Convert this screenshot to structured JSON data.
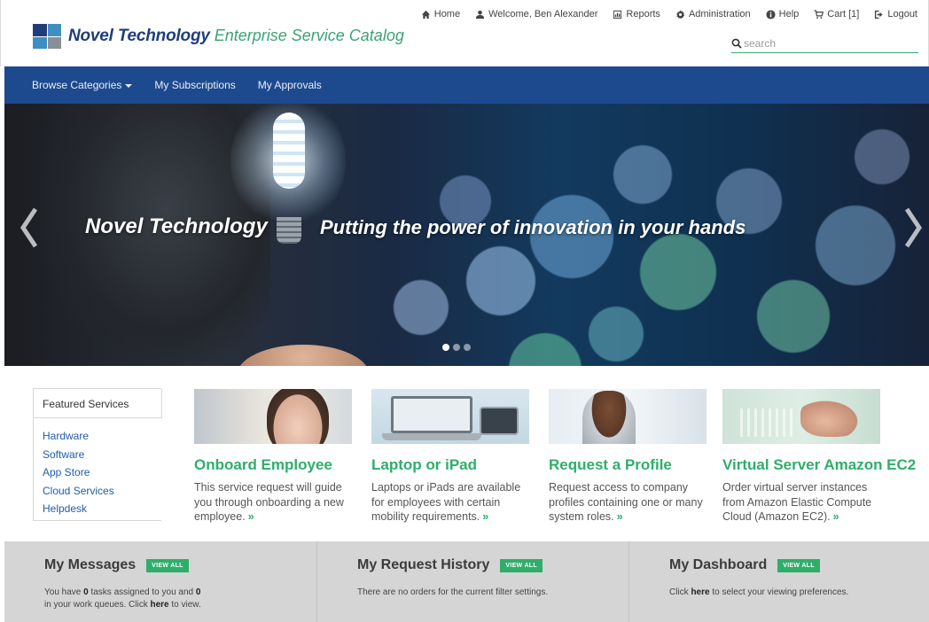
{
  "header": {
    "brand_name": "Novel Technology",
    "brand_sub": "Enterprise Service Catalog",
    "top_links": [
      {
        "icon": "home-icon",
        "label": "Home"
      },
      {
        "icon": "user-icon",
        "label": "Welcome, Ben Alexander"
      },
      {
        "icon": "chart-icon",
        "label": "Reports"
      },
      {
        "icon": "gear-icon",
        "label": "Administration"
      },
      {
        "icon": "info-icon",
        "label": "Help"
      },
      {
        "icon": "cart-icon",
        "label": "Cart [1]"
      },
      {
        "icon": "logout-icon",
        "label": "Logout"
      }
    ],
    "search_placeholder": "search",
    "accent_color": "#2fae6a",
    "brand_color": "#1f3d7a"
  },
  "nav": {
    "items": [
      "Browse Categories",
      "My Subscriptions",
      "My Approvals"
    ],
    "bg_color": "#1d4a8f"
  },
  "hero": {
    "title": "Novel Technology",
    "tagline": "Putting the power of innovation in your hands",
    "slide_count": 3,
    "active_slide": 1
  },
  "featured": {
    "heading": "Featured Services",
    "links": [
      "Hardware",
      "Software",
      "App Store",
      "Cloud Services",
      "Helpdesk"
    ]
  },
  "services": [
    {
      "title": "Onboard Employee",
      "desc": "This service request will guide you through onboarding a new employee.",
      "more": "»"
    },
    {
      "title": "Laptop or iPad",
      "desc": "Laptops or iPads are available for employees with certain mobility requirements.",
      "more": "»"
    },
    {
      "title": "Request a Profile",
      "desc": "Request access to company profiles containing one or many system roles.",
      "more": "»"
    },
    {
      "title": "Virtual Server Amazon EC2",
      "desc": "Order virtual server instances from Amazon Elastic Compute Cloud (Amazon EC2).",
      "more": "»"
    }
  ],
  "panels": {
    "view_all": "VIEW ALL",
    "messages": {
      "title": "My Messages",
      "t1": "You have ",
      "n1": "0",
      "t2": " tasks assigned to you and ",
      "n2": "0",
      "t3": "in your work queues. Click ",
      "link": "here",
      "t4": " to view."
    },
    "history": {
      "title": "My Request History",
      "text": "There are no orders for the current filter settings."
    },
    "dashboard": {
      "title": "My Dashboard",
      "t1": "Click ",
      "link": "here",
      "t2": " to select your viewing preferences."
    }
  }
}
